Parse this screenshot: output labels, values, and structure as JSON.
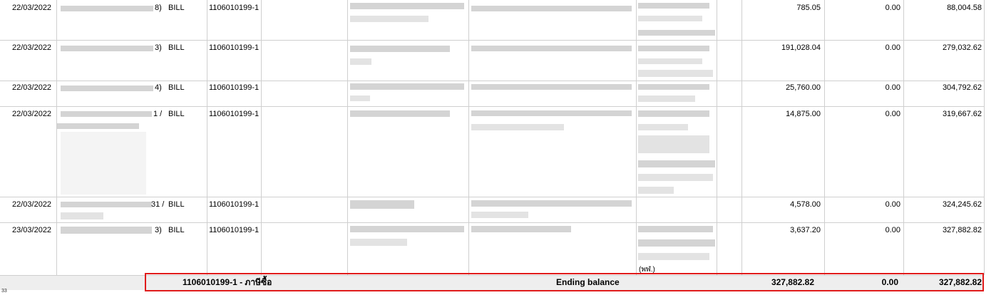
{
  "rows": [
    {
      "date": "22/03/2022",
      "ref_tail": "8)",
      "type": "BILL",
      "account": "1106010199-1",
      "debit": "785.05",
      "credit": "0.00",
      "balance": "88,004.58"
    },
    {
      "date": "22/03/2022",
      "ref_tail": "3)",
      "type": "BILL",
      "account": "1106010199-1",
      "debit": "191,028.04",
      "credit": "0.00",
      "balance": "279,032.62"
    },
    {
      "date": "22/03/2022",
      "ref_tail": "4)",
      "type": "BILL",
      "account": "1106010199-1",
      "debit": "25,760.00",
      "credit": "0.00",
      "balance": "304,792.62"
    },
    {
      "date": "22/03/2022",
      "ref_tail": "1 /",
      "type": "BILL",
      "account": "1106010199-1",
      "debit": "14,875.00",
      "credit": "0.00",
      "balance": "319,667.62"
    },
    {
      "date": "22/03/2022",
      "ref_tail": "31 /",
      "type": "BILL",
      "account": "1106010199-1",
      "debit": "4,578.00",
      "credit": "0.00",
      "balance": "324,245.62"
    },
    {
      "date": "23/03/2022",
      "ref_tail": "3)",
      "type": "BILL",
      "account": "1106010199-1",
      "debit": "3,637.20",
      "credit": "0.00",
      "balance": "327,882.82"
    }
  ],
  "row_fragment": "(พฬ.)",
  "footer": {
    "account_label": "1106010199-1 - ภาษีซื้อ",
    "description": "Ending balance",
    "debit": "327,882.82",
    "credit": "0.00",
    "balance": "327,882.82"
  },
  "page_number": "33"
}
